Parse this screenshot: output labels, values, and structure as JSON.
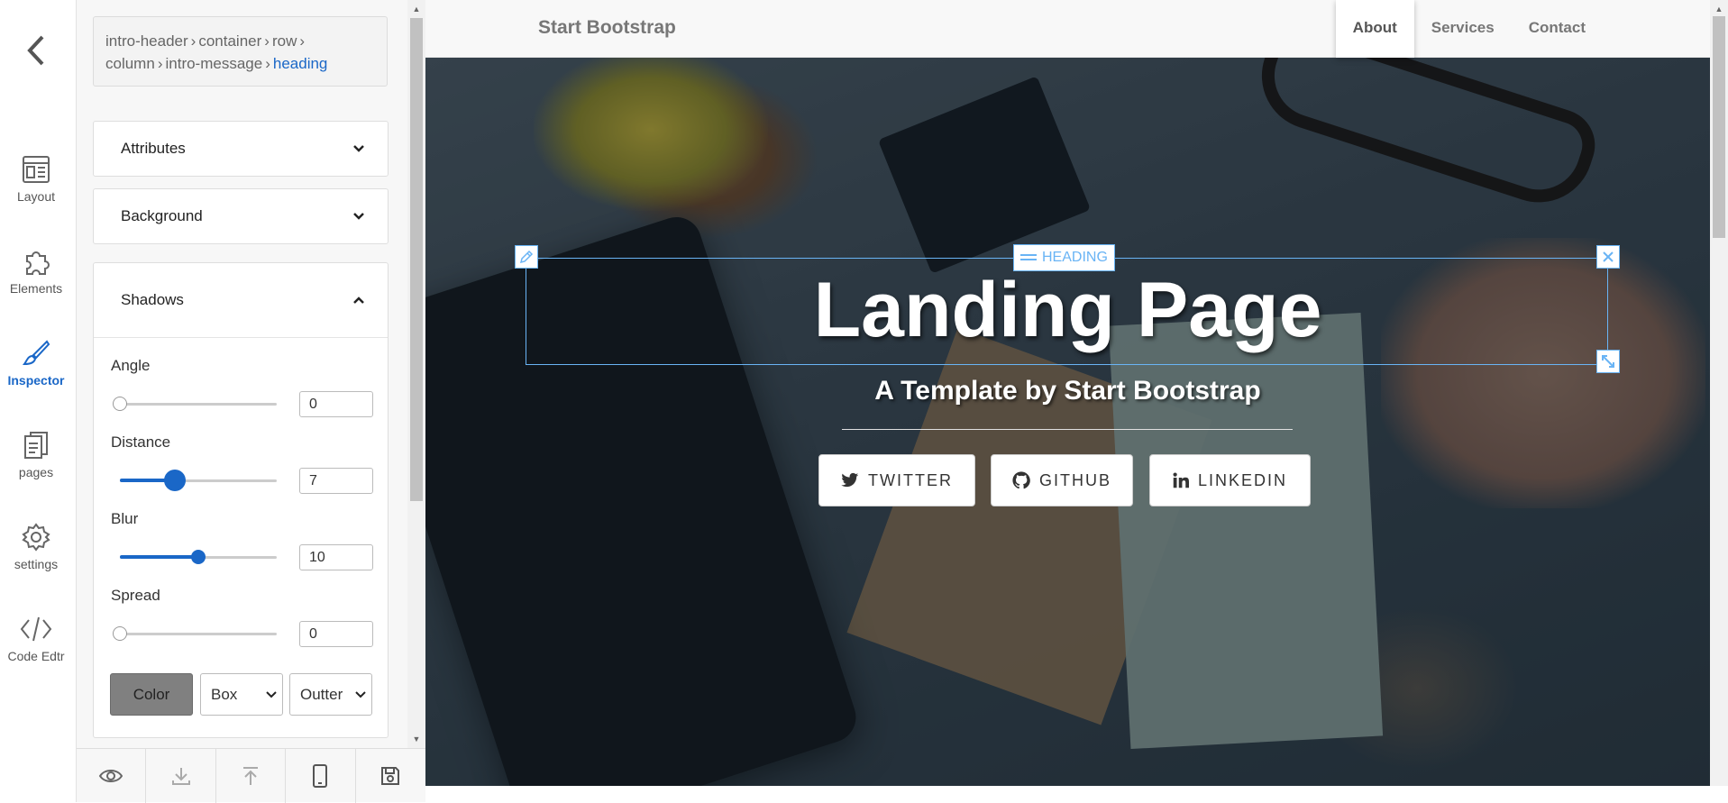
{
  "rail": {
    "items": [
      {
        "label": "Layout",
        "icon": "layout-icon"
      },
      {
        "label": "Elements",
        "icon": "puzzle-icon"
      },
      {
        "label": "Inspector",
        "icon": "brush-icon"
      },
      {
        "label": "pages",
        "icon": "pages-icon"
      },
      {
        "label": "settings",
        "icon": "gear-icon"
      },
      {
        "label": "Code Edtr",
        "icon": "code-icon"
      }
    ],
    "active_color": "#1a67c7"
  },
  "breadcrumb": {
    "parts": [
      "intro-header",
      "container",
      "row",
      "column",
      "intro-message"
    ],
    "current": "heading",
    "separator": "›"
  },
  "panel": {
    "attributes_label": "Attributes",
    "background_label": "Background",
    "shadows_label": "Shadows",
    "angle": {
      "label": "Angle",
      "value": "0",
      "level": 0.0
    },
    "distance": {
      "label": "Distance",
      "value": "7",
      "level": 0.35
    },
    "blur": {
      "label": "Blur",
      "value": "10",
      "level": 0.5
    },
    "spread": {
      "label": "Spread",
      "value": "0",
      "level": 0.0
    },
    "color_label": "Color",
    "type_select": "Box",
    "position_select": "Outter"
  },
  "toolbar": {
    "icons": [
      "eye-icon",
      "download-icon",
      "upload-icon",
      "mobile-icon",
      "save-icon"
    ]
  },
  "site": {
    "brand": "Start Bootstrap",
    "nav": [
      "About",
      "Services",
      "Contact"
    ],
    "title": "Landing Page",
    "subtitle": "A Template by Start Bootstrap",
    "buttons": [
      {
        "label": "TWITTER",
        "icon": "twitter-icon"
      },
      {
        "label": "GITHUB",
        "icon": "github-icon"
      },
      {
        "label": "LINKEDIN",
        "icon": "linkedin-icon"
      }
    ]
  },
  "selection": {
    "tag": "HEADING",
    "color": "#69b4f5"
  }
}
